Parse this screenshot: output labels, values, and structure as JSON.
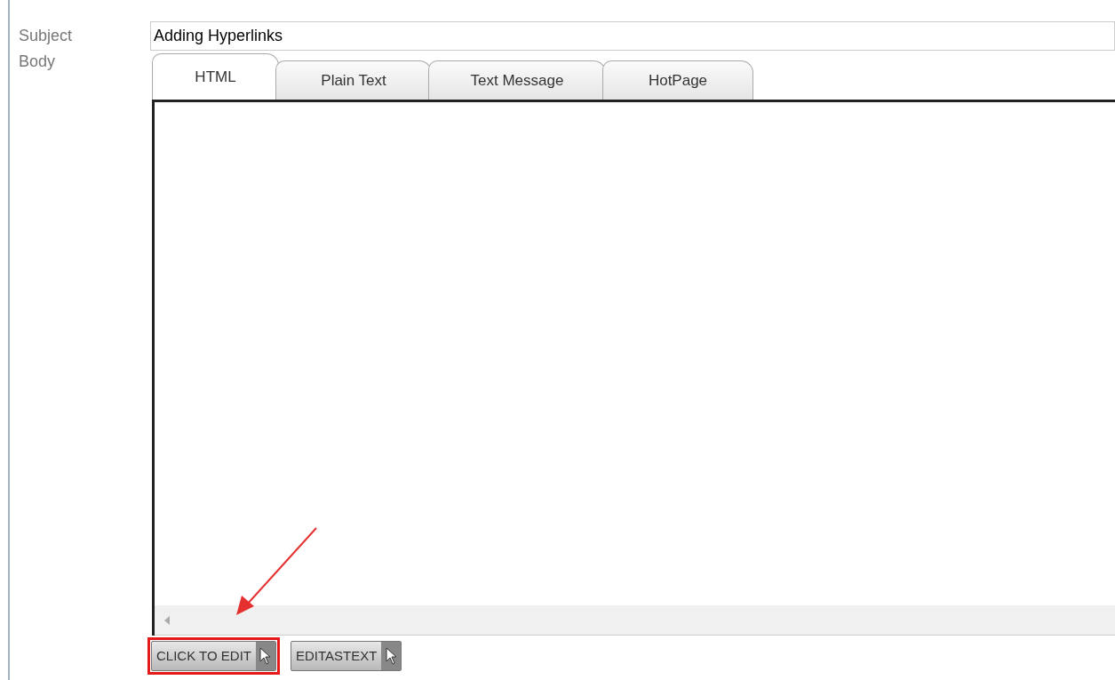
{
  "fields": [
    {
      "label": "Subject"
    },
    {
      "label": "Body"
    }
  ],
  "subject": {
    "value": "Adding Hyperlinks"
  },
  "tabs": [
    {
      "label": "HTML",
      "selected": true
    },
    {
      "label": "Plain Text",
      "selected": false
    },
    {
      "label": "Text Message",
      "selected": false
    },
    {
      "label": "HotPage",
      "selected": false
    }
  ],
  "buttons": [
    {
      "label": "CLICK TO EDIT",
      "highlighted": true
    },
    {
      "label": "EDITASTEXT",
      "highlighted": false
    }
  ]
}
